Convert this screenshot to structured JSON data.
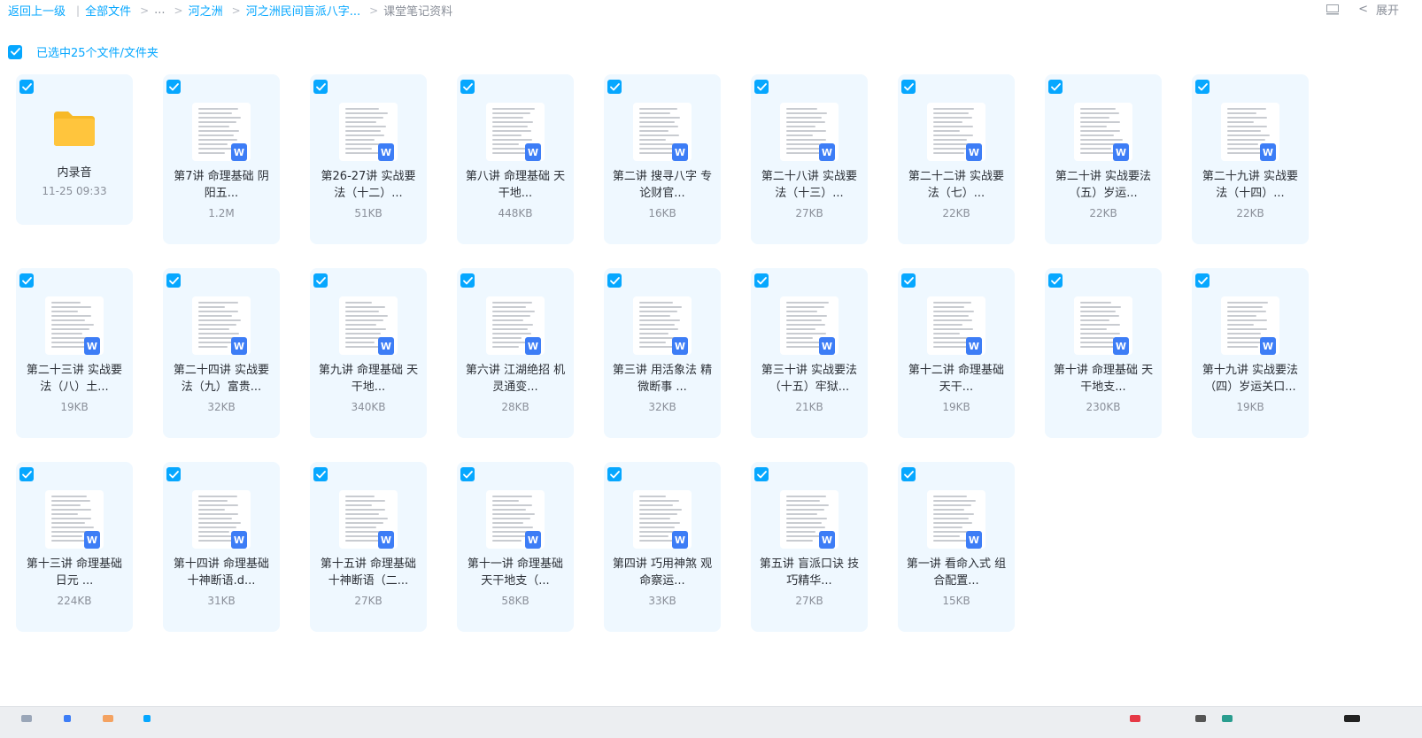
{
  "breadcrumb": {
    "back": "返回上一级",
    "items": [
      "全部文件",
      "...",
      "河之洲",
      "河之洲民间盲派八字...",
      "课堂笔记资料"
    ]
  },
  "toolbar": {
    "expand_label": "展开",
    "chevron": "<"
  },
  "selection": {
    "text": "已选中25个文件/文件夹"
  },
  "files": [
    {
      "type": "folder",
      "name": "内录音",
      "meta": "11-25 09:33"
    },
    {
      "type": "doc",
      "name": "第7讲 命理基础 阴\n阳五...",
      "meta": "1.2M"
    },
    {
      "type": "doc",
      "name": "第26-27讲 实战要\n法（十二）...",
      "meta": "51KB"
    },
    {
      "type": "doc",
      "name": "第八讲 命理基础 天\n干地...",
      "meta": "448KB"
    },
    {
      "type": "doc",
      "name": "第二讲 搜寻八字 专\n论财官...",
      "meta": "16KB"
    },
    {
      "type": "doc",
      "name": "第二十八讲 实战要\n法（十三）...",
      "meta": "27KB"
    },
    {
      "type": "doc",
      "name": "第二十二讲 实战要\n法（七）...",
      "meta": "22KB"
    },
    {
      "type": "doc",
      "name": "第二十讲 实战要法\n（五）岁运...",
      "meta": "22KB"
    },
    {
      "type": "doc",
      "name": "第二十九讲 实战要\n法（十四）...",
      "meta": "22KB"
    },
    {
      "type": "doc",
      "name": "第二十三讲 实战要\n法（八）土...",
      "meta": "19KB"
    },
    {
      "type": "doc",
      "name": "第二十四讲 实战要\n法（九）富贵...",
      "meta": "32KB"
    },
    {
      "type": "doc",
      "name": "第九讲 命理基础 天\n干地...",
      "meta": "340KB"
    },
    {
      "type": "doc",
      "name": "第六讲 江湖绝招 机\n灵通变...",
      "meta": "28KB"
    },
    {
      "type": "doc",
      "name": "第三讲 用活象法 精\n微断事 ...",
      "meta": "32KB"
    },
    {
      "type": "doc",
      "name": "第三十讲 实战要法\n（十五）牢狱...",
      "meta": "21KB"
    },
    {
      "type": "doc",
      "name": "第十二讲 命理基础\n天干...",
      "meta": "19KB"
    },
    {
      "type": "doc",
      "name": "第十讲 命理基础 天\n干地支...",
      "meta": "230KB"
    },
    {
      "type": "doc",
      "name": "第十九讲 实战要法\n（四）岁运关口...",
      "meta": "19KB"
    },
    {
      "type": "doc",
      "name": "第十三讲 命理基础\n日元 ...",
      "meta": "224KB"
    },
    {
      "type": "doc",
      "name": "第十四讲 命理基础\n十神断语.d...",
      "meta": "31KB"
    },
    {
      "type": "doc",
      "name": "第十五讲 命理基础\n十神断语（二...",
      "meta": "27KB"
    },
    {
      "type": "doc",
      "name": "第十一讲 命理基础\n天干地支（...",
      "meta": "58KB"
    },
    {
      "type": "doc",
      "name": "第四讲 巧用神煞 观\n命察运...",
      "meta": "33KB"
    },
    {
      "type": "doc",
      "name": "第五讲 盲派口诀 技\n巧精华...",
      "meta": "27KB"
    },
    {
      "type": "doc",
      "name": "第一讲 看命入式 组\n合配置...",
      "meta": "15KB"
    }
  ],
  "icons": {
    "checkbox": "checkbox-checked-icon",
    "folder": "folder-icon",
    "word": "word-doc-icon",
    "word_letter": "W"
  },
  "colors": {
    "accent": "#06a7ff",
    "card_bg": "#eff8ff",
    "word_badge": "#3d7df6",
    "folder": "#ffc53d"
  }
}
